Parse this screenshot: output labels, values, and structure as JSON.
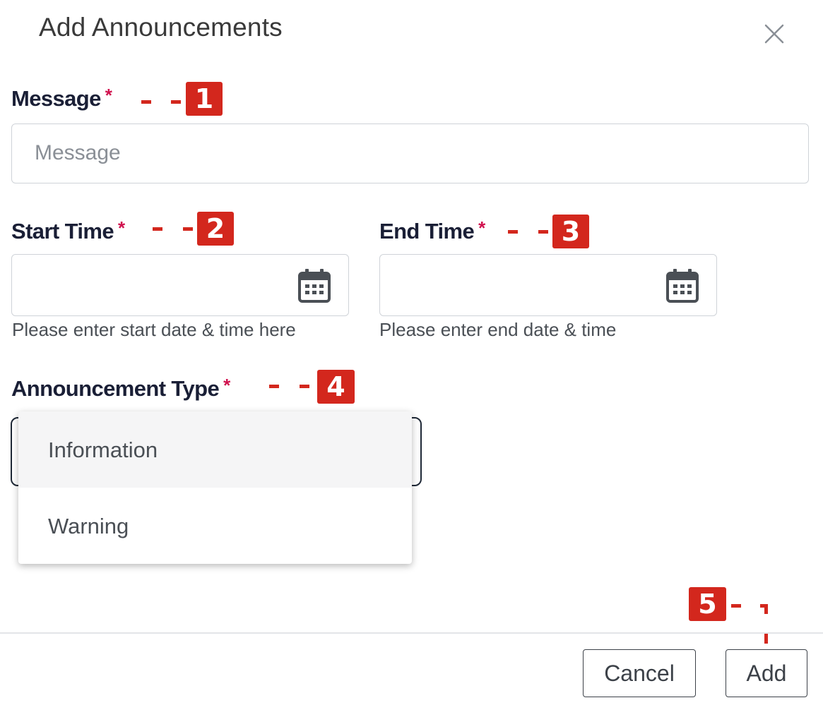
{
  "dialog": {
    "title": "Add Announcements",
    "close_icon": "close-icon"
  },
  "message": {
    "label": "Message",
    "required_mark": "*",
    "placeholder": "Message",
    "callout": "1"
  },
  "start_time": {
    "label": "Start Time",
    "required_mark": "*",
    "hint": "Please enter start date & time here",
    "icon": "calendar-icon",
    "callout": "2"
  },
  "end_time": {
    "label": "End Time",
    "required_mark": "*",
    "hint": "Please enter end date & time",
    "icon": "calendar-icon",
    "callout": "3"
  },
  "announcement_type": {
    "label": "Announcement Type",
    "required_mark": "*",
    "callout": "4",
    "options": [
      "Information",
      "Warning"
    ],
    "highlighted": "Information"
  },
  "footer": {
    "cancel_label": "Cancel",
    "add_label": "Add",
    "callout": "5"
  },
  "colors": {
    "callout": "#d3271d",
    "required": "#d0114e",
    "label": "#1a1f36"
  }
}
